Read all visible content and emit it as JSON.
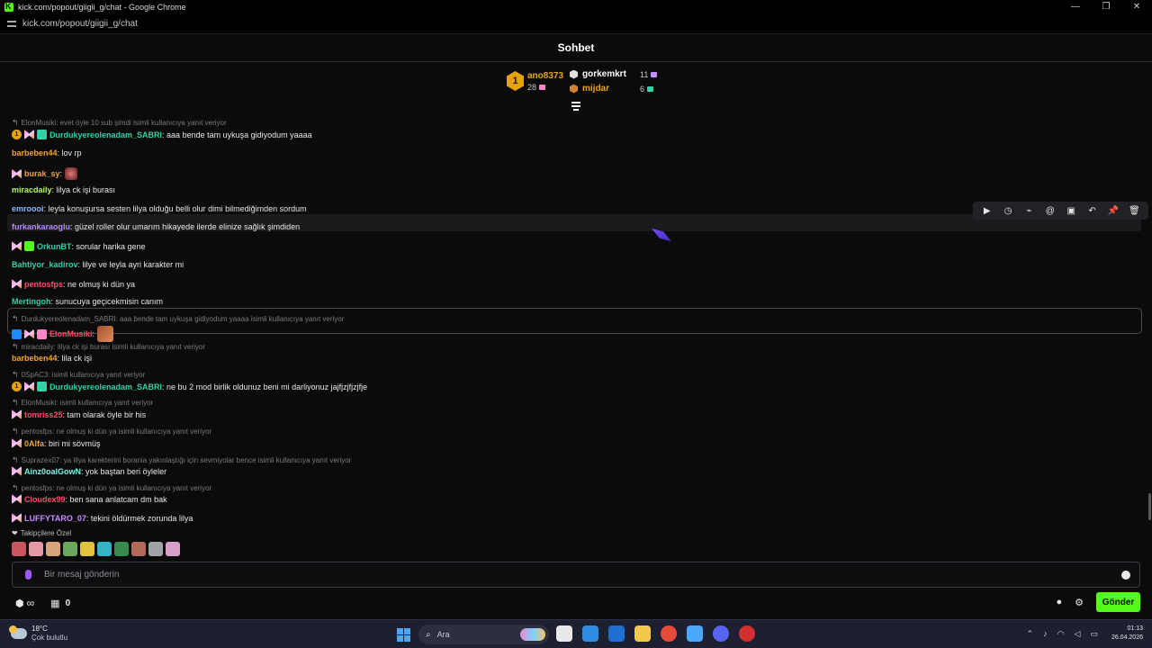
{
  "window": {
    "title": "kick.com/popout/giigii_g/chat - Google Chrome",
    "url": "kick.com/popout/giigii_g/chat",
    "controls": [
      "—",
      "❐",
      "✕"
    ]
  },
  "chat": {
    "title": "Sohbet"
  },
  "leaderboard": {
    "first": {
      "rank": "1",
      "name": "ano8373",
      "count": "28"
    },
    "rows": [
      {
        "name": "gorkemkrt",
        "count": "11",
        "color": "#ffffff",
        "medal": "#e0e0e0",
        "gift": "#c88cff"
      },
      {
        "name": "mijdar",
        "count": "6",
        "color": "#e8a323",
        "medal": "#d4812e",
        "gift": "#2fd3a7"
      }
    ]
  },
  "messages": [
    {
      "type": "reply",
      "text": "ElonMusiki: evet öyle 10 sub şimdi isimli kullanıcıya yanıt veriyor"
    },
    {
      "type": "msg",
      "badges": [
        "sub1",
        "fly",
        "gift"
      ],
      "user": "Durdukyereolenadam_SABRI",
      "color": "#2fd3a7",
      "text": ": aaa bende tam uykuşa gidiyodum yaaaa"
    },
    {
      "type": "msg",
      "badges": [],
      "user": "barbeben44",
      "color": "#f2a33a",
      "text": ": lov rp"
    },
    {
      "type": "msg",
      "badges": [
        "fly"
      ],
      "user": "burak_sy",
      "color": "#f2a33a",
      "text": ": ",
      "emote": true
    },
    {
      "type": "msg",
      "badges": [],
      "user": "miracdaily",
      "color": "#b6f36c",
      "text": ": lilya ck işi burası"
    },
    {
      "type": "msg",
      "badges": [],
      "user": "emroooi",
      "color": "#8eb8ff",
      "text": ": leyla konuşursa sesten lilya olduğu belli olur dimi bilmediğimden sordum"
    },
    {
      "type": "msg",
      "badges": [],
      "user": "furkankaraoglu",
      "color": "#b48cff",
      "text": ": güzel roller olur umarım hikayede ilerde elinize sağlık şimdiden"
    },
    {
      "type": "msg",
      "badges": [
        "fly",
        "giftg"
      ],
      "user": "OrkunBT",
      "color": "#2fd3a7",
      "text": ": sorular harika gene"
    },
    {
      "type": "msg",
      "badges": [],
      "user": "Bahtiyor_kadirov",
      "color": "#2fd3a7",
      "text": ": lilye ve leyla ayri karakter mi"
    },
    {
      "type": "msg",
      "badges": [
        "fly"
      ],
      "user": "pentosfps",
      "color": "#ff4d6a",
      "text": ": ne olmuş ki dün ya"
    },
    {
      "type": "msg",
      "badges": [],
      "user": "Mertingoh",
      "color": "#2fd3a7",
      "text": ": sunucuya geçicekmisin canım"
    },
    {
      "type": "reply",
      "text": "Durdukyereolenadam_SABRI: aaa bende tam uykuşa gidiyodum yaaaa isimli kullanıcıya yanıt veriyor"
    },
    {
      "type": "msg",
      "badges": [
        "blue",
        "fly",
        "giftp"
      ],
      "user": "ElonMusiki",
      "color": "#ff4d6a",
      "text": ": ",
      "emote": true
    },
    {
      "type": "reply",
      "text": "miracdaily: lilya ck işi burası isimli kullanıcıya yanıt veriyor"
    },
    {
      "type": "msg",
      "badges": [],
      "user": "barbeben44",
      "color": "#f2a33a",
      "text": ": lila ck işi"
    },
    {
      "type": "reply",
      "text": "0SpAC3:     isimli kullanıcıya yanıt veriyor"
    },
    {
      "type": "msg",
      "badges": [
        "sub1",
        "fly",
        "gift"
      ],
      "user": "Durdukyereolenadam_SABRI",
      "color": "#2fd3a7",
      "text": ": ne bu 2 mod birlik oldunuz beni mi darliyonuz jajfjzjfjzjfje"
    },
    {
      "type": "reply",
      "text": "ElonMusiki:        isimli kullanıcıya yanıt veriyor"
    },
    {
      "type": "msg",
      "badges": [
        "fly"
      ],
      "user": "tomriss25",
      "color": "#ff4d6a",
      "text": ": tam olarak öyle bir his"
    },
    {
      "type": "reply",
      "text": "pentosfps: ne olmuş ki dün ya isimli kullanıcıya yanıt veriyor"
    },
    {
      "type": "msg",
      "badges": [
        "fly"
      ],
      "user": "0Alfa",
      "color": "#f2a33a",
      "text": ": biri mi sövmüş"
    },
    {
      "type": "reply",
      "text": "Suprazex07: ya lilya karekterini borania yakınlaştığı için sevmiyolar bence isimli kullanıcıya yanıt veriyor"
    },
    {
      "type": "msg",
      "badges": [
        "fly"
      ],
      "user": "Ainz0oalGowN",
      "color": "#7ef0e0",
      "text": ": yok baştan beri öyleler"
    },
    {
      "type": "reply",
      "text": "pentosfps: ne olmuş ki dün ya isimli kullanıcıya yanıt veriyor"
    },
    {
      "type": "msg",
      "badges": [
        "fly"
      ],
      "user": "Cloudex99",
      "color": "#ff4d6a",
      "text": ": ben sana anlatcam dm bak"
    },
    {
      "type": "msg",
      "badges": [
        "fly"
      ],
      "user": "LUFFYTARO_07",
      "color": "#c88cff",
      "text": ": tekini öldürmek zorunda lilya"
    }
  ],
  "mod_tools": [
    "▶",
    "◷",
    "⌁",
    "@",
    "▣",
    "↶",
    "📌",
    "🗑"
  ],
  "followers": {
    "label": "Takipçilere Özel",
    "emote_colors": [
      "#c9565e",
      "#e59aa8",
      "#d9a47a",
      "#6aa85c",
      "#e2c43a",
      "#2fb7c6",
      "#3a8a4e",
      "#b36a5b",
      "#9fa3a8",
      "#d8a0c8"
    ]
  },
  "input": {
    "placeholder": "Bir mesaj gönderin"
  },
  "bottom": {
    "infinity": "∞",
    "store_count": "0",
    "send_label": "Gönder"
  },
  "taskbar": {
    "temp": "18°C",
    "weather": "Çok bulutlu",
    "search_label": "Ara",
    "time": "01:13",
    "date": "26.04.2026",
    "app_colors": [
      "#e8e8e8",
      "#2e8de3",
      "#1f6fd1",
      "#f2c94c",
      "#e84b3a",
      "#4aa8ff",
      "#5865f2",
      "#d23030"
    ]
  }
}
